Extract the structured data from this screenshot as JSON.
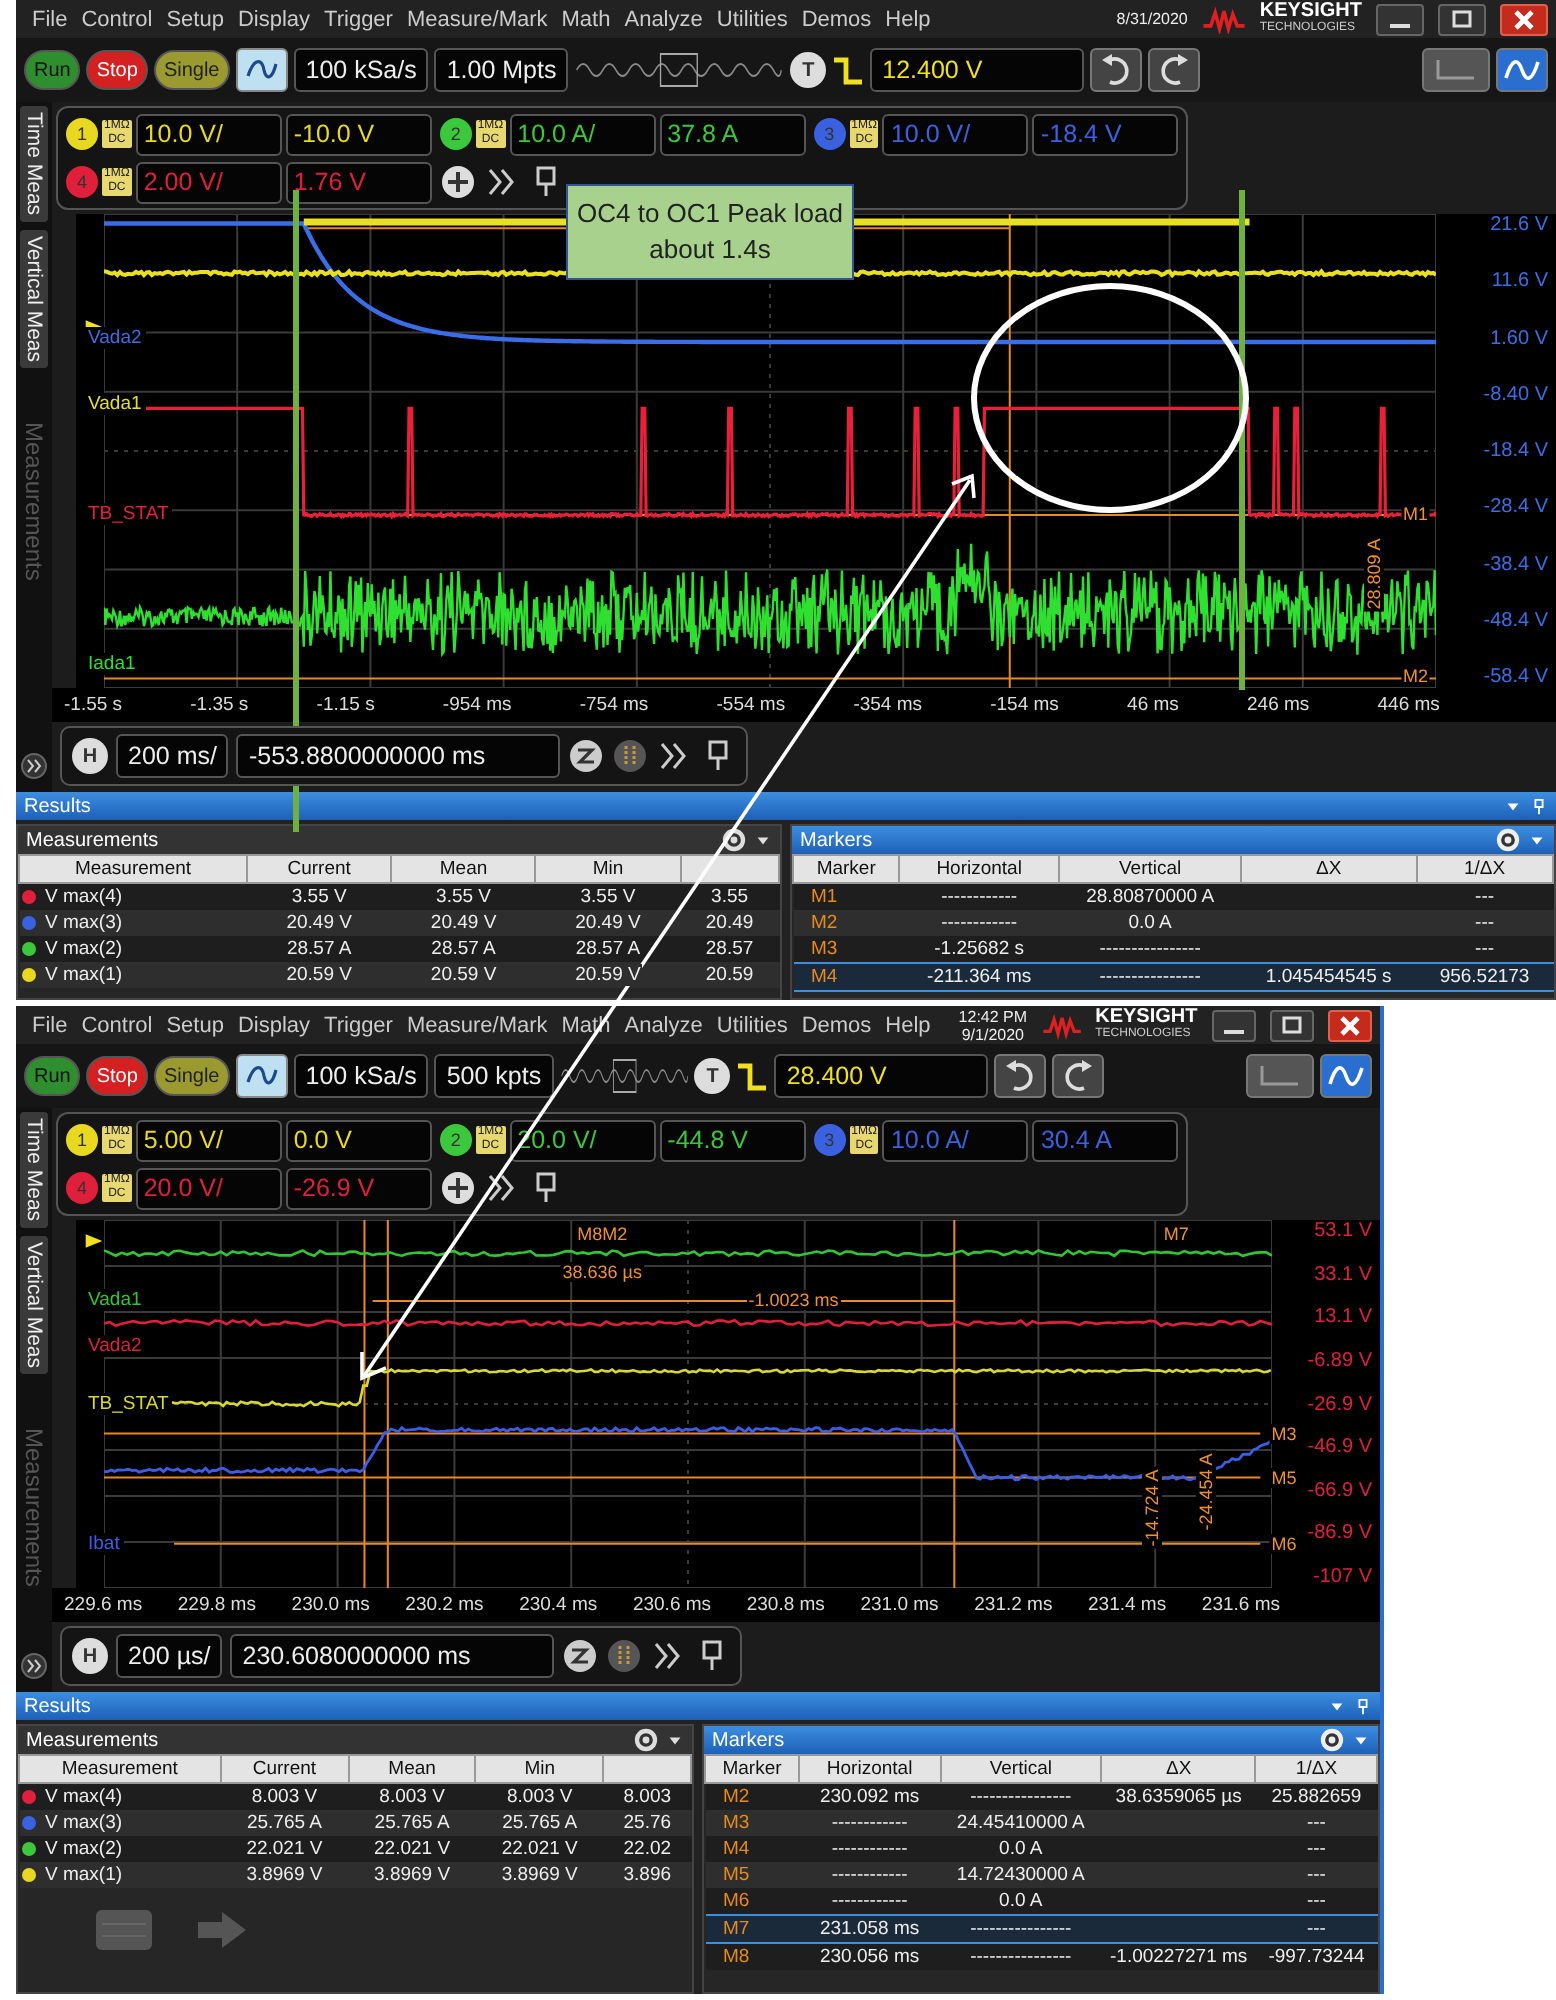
{
  "scopes": [
    {
      "menu": [
        "File",
        "Control",
        "Setup",
        "Display",
        "Trigger",
        "Measure/Mark",
        "Math",
        "Analyze",
        "Utilities",
        "Demos",
        "Help"
      ],
      "clock": [
        "8/31/2020"
      ],
      "brand": "KEYSIGHT",
      "brand_sub": "TECHNOLOGIES",
      "run_controls": [
        {
          "label": "Run",
          "kind": "run"
        },
        {
          "label": "Stop",
          "kind": "stop"
        },
        {
          "label": "Single",
          "kind": "single"
        }
      ],
      "sample_rate": "100 kSa/s",
      "memory_depth": "1.00 Mpts",
      "trigger_badge": "T",
      "trigger_level": "12.400 V",
      "channels": [
        {
          "number": "1",
          "impedance": "1MΩ",
          "coupling": "DC",
          "scale": "10.0 V/",
          "offset": "-10.0 V",
          "color": "#e8d820"
        },
        {
          "number": "2",
          "impedance": "1MΩ",
          "coupling": "DC",
          "scale": "10.0 A/",
          "offset": "37.8 A",
          "color": "#3cc83c"
        },
        {
          "number": "3",
          "impedance": "1MΩ",
          "coupling": "DC",
          "scale": "10.0 V/",
          "offset": "-18.4 V",
          "color": "#3a62e0"
        },
        {
          "number": "4",
          "impedance": "1MΩ",
          "coupling": "DC",
          "scale": "2.00 V/",
          "offset": "1.76 V",
          "color": "#e0203a"
        }
      ],
      "side_tabs": [
        {
          "label": "Time Meas",
          "faded": false
        },
        {
          "label": "Vertical Meas",
          "faded": false
        },
        {
          "label": "Measurements",
          "faded": true
        }
      ],
      "traces": [
        {
          "label": "Vada2",
          "color": "#3a6ee8"
        },
        {
          "label": "Vada1",
          "color": "#e8e020"
        },
        {
          "label": "TB_STAT",
          "color": "#e8203a"
        },
        {
          "label": "Iada1",
          "color": "#30e030"
        }
      ],
      "y_axis": {
        "color": "#3a6ee8",
        "ticks": [
          "21.6 V",
          "11.6 V",
          "1.60 V",
          "-8.40 V",
          "-18.4 V",
          "-28.4 V",
          "-38.4 V",
          "-48.4 V",
          "-58.4 V"
        ]
      },
      "x_ticks": [
        "-1.55 s",
        "-1.35 s",
        "-1.15 s",
        "-954 ms",
        "-754 ms",
        "-554 ms",
        "-354 ms",
        "-154 ms",
        "46 ms",
        "246 ms",
        "446 ms"
      ],
      "marker_labels": [
        {
          "text": "M1",
          "kind": "tag"
        },
        {
          "text": "M2",
          "kind": "tag"
        },
        {
          "text": "28.809 A",
          "kind": "vertical"
        }
      ],
      "timebase": {
        "badge": "H",
        "scale": "200 ms/",
        "position": "-553.8800000000 ms"
      },
      "results": {
        "title": "Results",
        "measurements": {
          "title": "Measurements",
          "columns": [
            "Measurement",
            "Current",
            "Mean",
            "Min"
          ],
          "rows": [
            {
              "color": "#e0203a",
              "cells": [
                "V max(4)",
                "3.55 V",
                "3.55 V",
                "3.55 V",
                "3.55"
              ]
            },
            {
              "color": "#3a62e0",
              "cells": [
                "V max(3)",
                "20.49 V",
                "20.49 V",
                "20.49 V",
                "20.49"
              ]
            },
            {
              "color": "#3cc83c",
              "cells": [
                "V max(2)",
                "28.57 A",
                "28.57 A",
                "28.57 A",
                "28.57"
              ]
            },
            {
              "color": "#e8d820",
              "cells": [
                "V max(1)",
                "20.59 V",
                "20.59 V",
                "20.59 V",
                "20.59"
              ]
            }
          ]
        },
        "markers": {
          "title": "Markers",
          "columns": [
            "Marker",
            "Horizontal",
            "Vertical",
            "ΔX",
            "1/ΔX"
          ],
          "rows": [
            {
              "selected": false,
              "marker": "M1",
              "horizontal": "------------",
              "vertical": "28.80870000 A",
              "inv_dx": "---"
            },
            {
              "selected": false,
              "marker": "M2",
              "horizontal": "------------",
              "vertical": "0.0 A",
              "inv_dx": "---"
            },
            {
              "selected": false,
              "marker": "M3",
              "horizontal": "-1.25682 s",
              "vertical": "----------------",
              "inv_dx": "---"
            },
            {
              "selected": true,
              "marker": "M4",
              "horizontal": "-211.364 ms",
              "vertical": "----------------",
              "dx": "1.045454545 s",
              "inv_dx": "956.52173"
            }
          ]
        }
      }
    },
    {
      "menu": [
        "File",
        "Control",
        "Setup",
        "Display",
        "Trigger",
        "Measure/Mark",
        "Math",
        "Analyze",
        "Utilities",
        "Demos",
        "Help"
      ],
      "clock": [
        "12:42 PM",
        "9/1/2020"
      ],
      "brand": "KEYSIGHT",
      "brand_sub": "TECHNOLOGIES",
      "run_controls": [
        {
          "label": "Run",
          "kind": "run"
        },
        {
          "label": "Stop",
          "kind": "stop"
        },
        {
          "label": "Single",
          "kind": "single"
        }
      ],
      "sample_rate": "100 kSa/s",
      "memory_depth": "500 kpts",
      "trigger_badge": "T",
      "trigger_level": "28.400 V",
      "channels": [
        {
          "number": "1",
          "impedance": "1MΩ",
          "coupling": "DC",
          "scale": "5.00 V/",
          "offset": "0.0 V",
          "color": "#e8d820"
        },
        {
          "number": "2",
          "impedance": "1MΩ",
          "coupling": "DC",
          "scale": "20.0 V/",
          "offset": "-44.8 V",
          "color": "#3cc83c"
        },
        {
          "number": "3",
          "impedance": "1MΩ",
          "coupling": "DC",
          "scale": "10.0 A/",
          "offset": "30.4 A",
          "color": "#3a62e0"
        },
        {
          "number": "4",
          "impedance": "1MΩ",
          "coupling": "DC",
          "scale": "20.0 V/",
          "offset": "-26.9 V",
          "color": "#e0203a"
        }
      ],
      "side_tabs": [
        {
          "label": "Time Meas",
          "faded": false
        },
        {
          "label": "Vertical Meas",
          "faded": false
        },
        {
          "label": "Measurements",
          "faded": true
        }
      ],
      "traces": [
        {
          "label": "Vada1",
          "color": "#30c830"
        },
        {
          "label": "Vada2",
          "color": "#e0203a"
        },
        {
          "label": "TB_STAT",
          "color": "#d8d830"
        },
        {
          "label": "Ibat",
          "color": "#3a5ee8"
        }
      ],
      "y_axis": {
        "color": "#e0203a",
        "ticks": [
          "53.1 V",
          "33.1 V",
          "13.1 V",
          "-6.89 V",
          "-26.9 V",
          "-46.9 V",
          "-66.9 V",
          "-86.9 V",
          "-107 V"
        ]
      },
      "x_ticks": [
        "229.6 ms",
        "229.8 ms",
        "230.0 ms",
        "230.2 ms",
        "230.4 ms",
        "230.6 ms",
        "230.8 ms",
        "231.0 ms",
        "231.2 ms",
        "231.4 ms",
        "231.6 ms"
      ],
      "marker_labels": [
        {
          "text": "M8M2",
          "kind": "tag"
        },
        {
          "text": "38.636 µs",
          "kind": "tag"
        },
        {
          "text": "M7",
          "kind": "tag"
        },
        {
          "text": "-1.0023 ms",
          "kind": "tag"
        },
        {
          "text": "M3",
          "kind": "tag"
        },
        {
          "text": "M5",
          "kind": "tag"
        },
        {
          "text": "M6",
          "kind": "tag"
        },
        {
          "text": "-24.454 A",
          "kind": "vertical"
        },
        {
          "text": "-14.724 A",
          "kind": "vertical"
        }
      ],
      "timebase": {
        "badge": "H",
        "scale": "200 µs/",
        "position": "230.6080000000 ms"
      },
      "results": {
        "title": "Results",
        "faded_icons": true,
        "measurements": {
          "title": "Measurements",
          "columns": [
            "Measurement",
            "Current",
            "Mean",
            "Min"
          ],
          "rows": [
            {
              "color": "#e0203a",
              "cells": [
                "V max(4)",
                "8.003 V",
                "8.003 V",
                "8.003 V",
                "8.003"
              ]
            },
            {
              "color": "#3a62e0",
              "cells": [
                "V max(3)",
                "25.765 A",
                "25.765 A",
                "25.765 A",
                "25.76"
              ]
            },
            {
              "color": "#3cc83c",
              "cells": [
                "V max(2)",
                "22.021 V",
                "22.021 V",
                "22.021 V",
                "22.02"
              ]
            },
            {
              "color": "#e8d820",
              "cells": [
                "V max(1)",
                "3.8969 V",
                "3.8969 V",
                "3.8969 V",
                "3.896"
              ]
            }
          ]
        },
        "markers": {
          "title": "Markers",
          "columns": [
            "Marker",
            "Horizontal",
            "Vertical",
            "ΔX",
            "1/ΔX"
          ],
          "rows": [
            {
              "selected": false,
              "marker": "M2",
              "horizontal": "230.092 ms",
              "vertical": "----------------",
              "dx": "38.6359065 µs",
              "inv_dx": "25.882659"
            },
            {
              "selected": false,
              "marker": "M3",
              "horizontal": "------------",
              "vertical": "24.45410000 A",
              "inv_dx": "---"
            },
            {
              "selected": false,
              "marker": "M4",
              "horizontal": "------------",
              "vertical": "0.0 A",
              "inv_dx": "---"
            },
            {
              "selected": false,
              "marker": "M5",
              "horizontal": "------------",
              "vertical": "14.72430000 A",
              "inv_dx": "---"
            },
            {
              "selected": false,
              "marker": "M6",
              "horizontal": "------------",
              "vertical": "0.0 A",
              "inv_dx": "---"
            },
            {
              "selected": true,
              "marker": "M7",
              "horizontal": "231.058 ms",
              "vertical": "----------------",
              "inv_dx": "---"
            },
            {
              "selected": false,
              "marker": "M8",
              "horizontal": "230.056 ms",
              "vertical": "----------------",
              "dx": "-1.00227271 ms",
              "inv_dx": "-997.73244"
            }
          ]
        }
      }
    }
  ],
  "annotation": {
    "callout": "OC4 to OC1 Peak load about 1.4s"
  }
}
